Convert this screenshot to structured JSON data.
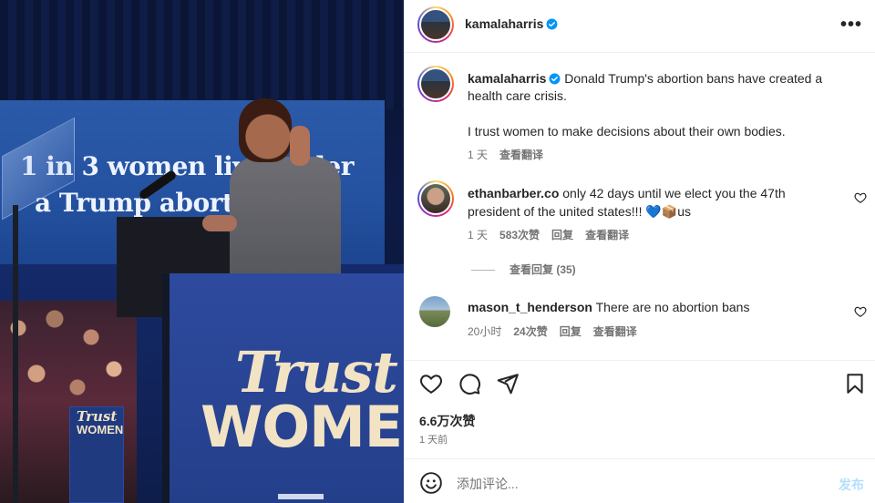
{
  "photo": {
    "screen_line_1": "1 in 3 women live under",
    "screen_line_2": "a Trump abortion ban",
    "podium_line_1": "Trust",
    "podium_line_2": "WOMEN",
    "sign_line_1": "Trust",
    "sign_line_2": "WOMEN"
  },
  "header": {
    "username": "kamalaharris",
    "more_icon": "more-horizontal-icon"
  },
  "caption": {
    "username": "kamalaharris",
    "text_line_1": "Donald Trump's abortion bans have created a",
    "text_line_2": "health care crisis.",
    "text_line_3": "I trust women to make decisions about their own bodies.",
    "time": "1 天",
    "translate": "查看翻译"
  },
  "comments": [
    {
      "username": "ethanbarber.co",
      "text_line_1": "only 42 days until we elect you the 47th",
      "text_line_2": "president of the united states!!! 💙📦us",
      "time": "1 天",
      "likes": "583次赞",
      "reply": "回复",
      "translate": "查看翻译",
      "view_replies": "查看回复 (35)"
    },
    {
      "username": "mason_t_henderson",
      "text": "There are no abortion bans",
      "time": "20小时",
      "likes": "24次赞",
      "reply": "回复",
      "translate": "查看翻译"
    }
  ],
  "actions": {
    "like_icon": "heart-icon",
    "comment_icon": "comment-icon",
    "share_icon": "send-icon",
    "save_icon": "bookmark-icon"
  },
  "stats": {
    "likes": "6.6万次赞",
    "date": "1 天前"
  },
  "composer": {
    "placeholder": "添加评论...",
    "post_label": "发布"
  },
  "colors": {
    "verified": "#0095f6",
    "post_button": "#b2dffc",
    "podium": "#2e4a9e"
  }
}
